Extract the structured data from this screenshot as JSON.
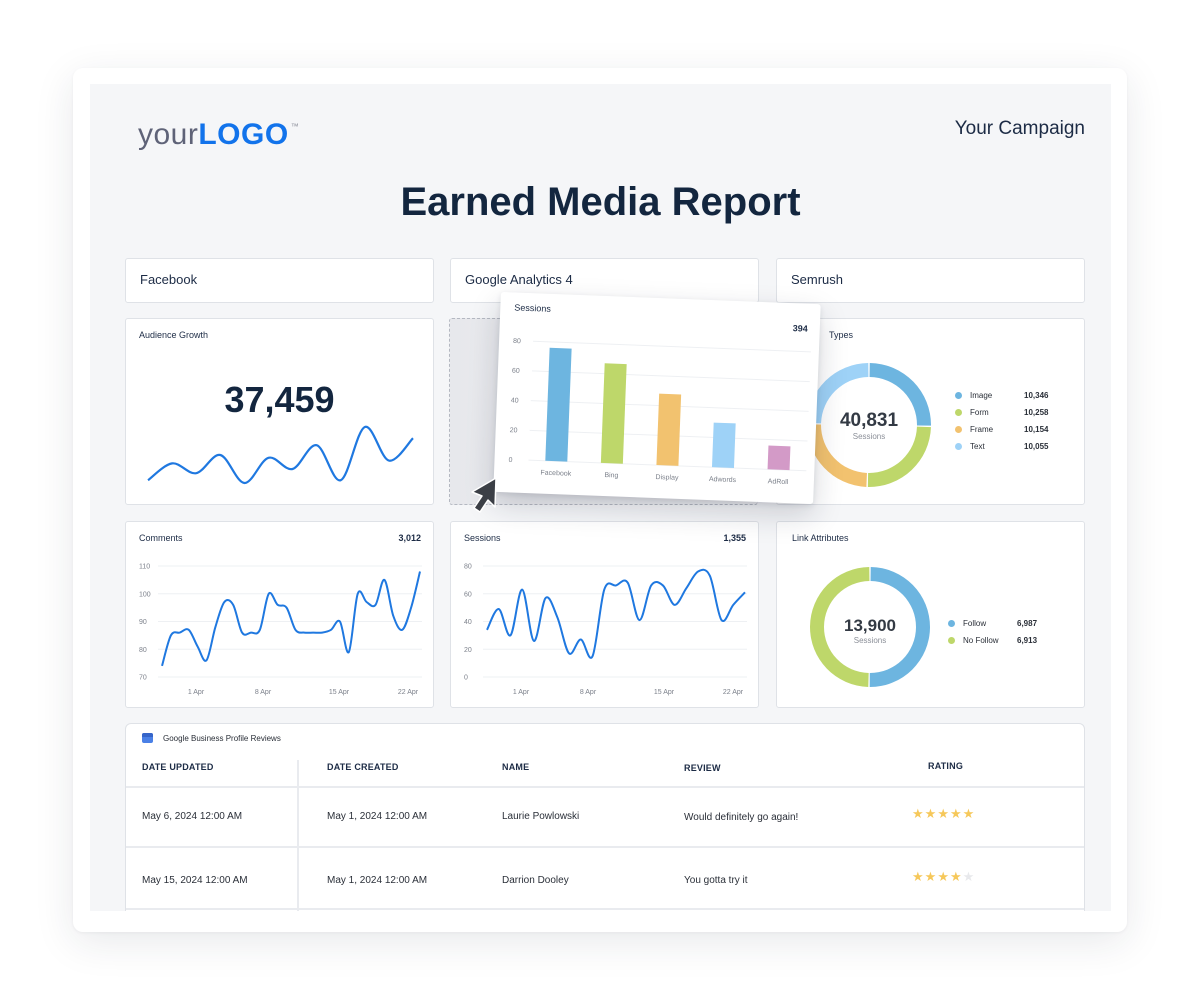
{
  "header": {
    "logo_prefix": "your",
    "logo_brand": "LOGO",
    "logo_tm": "™",
    "campaign": "Your Campaign",
    "title": "Earned Media Report"
  },
  "sources": [
    "Facebook",
    "Google Analytics 4",
    "Semrush"
  ],
  "audience_growth": {
    "title": "Audience Growth",
    "value": "37,459",
    "sparkline": [
      10,
      22,
      15,
      28,
      8,
      26,
      18,
      35,
      10,
      48,
      24,
      40
    ]
  },
  "sessions_bar": {
    "title": "Sessions",
    "total": "394",
    "chart_data": {
      "type": "bar",
      "categories": [
        "Facebook",
        "Bing",
        "Display",
        "Adwords",
        "AdRoll"
      ],
      "values": [
        76,
        67,
        48,
        30,
        16
      ],
      "colors": [
        "#6db5e0",
        "#bed76a",
        "#f2c26f",
        "#9ed2f7",
        "#d39ac7"
      ],
      "yticks": [
        0,
        20,
        40,
        60,
        80
      ],
      "ylim": [
        0,
        80
      ]
    }
  },
  "types": {
    "title": "Types",
    "center_value": "40,831",
    "center_label": "Sessions",
    "chart_data": {
      "type": "pie",
      "labels": [
        "Image",
        "Form",
        "Frame",
        "Text"
      ],
      "display_values": [
        "10,346",
        "10,258",
        "10,154",
        "10,055"
      ],
      "values": [
        10346,
        10258,
        10154,
        10055
      ],
      "colors": [
        "#6db5e0",
        "#bed76a",
        "#f2c26f",
        "#9ed2f7"
      ]
    }
  },
  "comments": {
    "title": "Comments",
    "total": "3,012",
    "chart_data": {
      "type": "line",
      "xticks": [
        "1 Apr",
        "8 Apr",
        "15 Apr",
        "22 Apr"
      ],
      "yticks": [
        70,
        80,
        90,
        100,
        110
      ],
      "ylim": [
        70,
        110
      ],
      "values": [
        74,
        85,
        86,
        87,
        81,
        76,
        88,
        97,
        96,
        86,
        86,
        87,
        100,
        96,
        95,
        87,
        86,
        86,
        86,
        87,
        90,
        79,
        100,
        97,
        96,
        105,
        92,
        87,
        95,
        108
      ],
      "color": "#1f78e0"
    }
  },
  "sessions_line": {
    "title": "Sessions",
    "total": "1,355",
    "chart_data": {
      "type": "line",
      "xticks": [
        "1 Apr",
        "8 Apr",
        "15 Apr",
        "22 Apr"
      ],
      "yticks": [
        0,
        20,
        40,
        60,
        80
      ],
      "ylim": [
        0,
        80
      ],
      "values": [
        34,
        49,
        30,
        63,
        26,
        57,
        43,
        17,
        27,
        15,
        63,
        66,
        68,
        41,
        66,
        66,
        52,
        64,
        76,
        73,
        41,
        52,
        61
      ],
      "color": "#1f78e0"
    }
  },
  "link_attributes": {
    "title": "Link Attributes",
    "center_value": "13,900",
    "center_label": "Sessions",
    "chart_data": {
      "type": "pie",
      "labels": [
        "Follow",
        "No Follow"
      ],
      "display_values": [
        "6,987",
        "6,913"
      ],
      "values": [
        6987,
        6913
      ],
      "colors": [
        "#6db5e0",
        "#bed76a"
      ]
    }
  },
  "reviews": {
    "source": "Google Business Profile Reviews",
    "columns": [
      "DATE UPDATED",
      "DATE CREATED",
      "NAME",
      "REVIEW",
      "RATING"
    ],
    "rows": [
      {
        "date_updated": "May 6, 2024 12:00 AM",
        "date_created": "May 1, 2024 12:00 AM",
        "name": "Laurie Powlowski",
        "review": "Would definitely go again!",
        "rating": 5
      },
      {
        "date_updated": "May 15, 2024 12:00 AM",
        "date_created": "May 1, 2024 12:00 AM",
        "name": "Darrion Dooley",
        "review": "You gotta try it",
        "rating": 4
      }
    ],
    "max_rating": 5
  }
}
